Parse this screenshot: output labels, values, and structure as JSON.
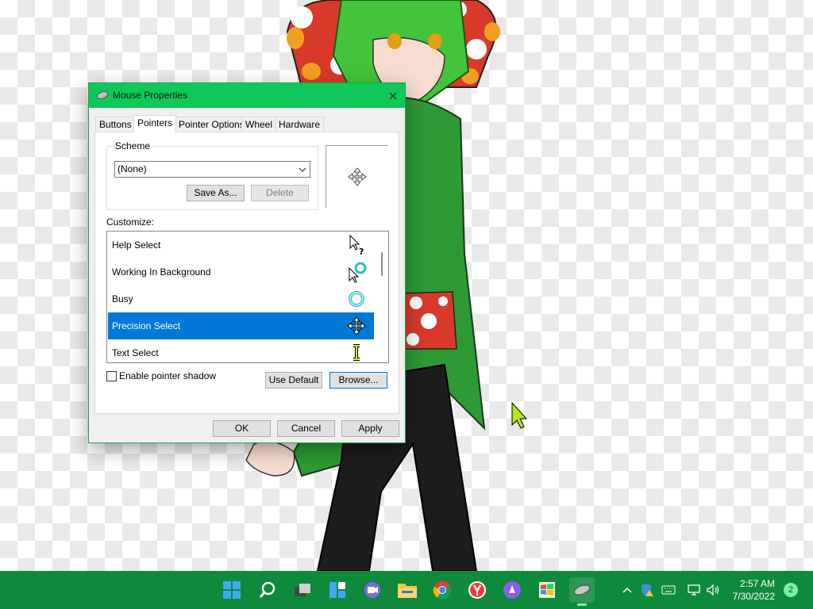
{
  "window": {
    "title": "Mouse Properties",
    "tabs": [
      "Buttons",
      "Pointers",
      "Pointer Options",
      "Wheel",
      "Hardware"
    ],
    "active_tab": "Pointers"
  },
  "scheme": {
    "legend": "Scheme",
    "selected": "(None)",
    "save_as_label": "Save As...",
    "delete_label": "Delete"
  },
  "customize": {
    "label": "Customize:",
    "items": [
      {
        "label": "Help Select",
        "icon": "help-select-cursor-icon"
      },
      {
        "label": "Working In Background",
        "icon": "working-in-background-cursor-icon"
      },
      {
        "label": "Busy",
        "icon": "busy-cursor-icon"
      },
      {
        "label": "Precision Select",
        "icon": "move-cursor-icon",
        "selected": true
      },
      {
        "label": "Text Select",
        "icon": "text-select-cursor-icon"
      }
    ]
  },
  "options": {
    "shadow_label": "Enable pointer shadow",
    "shadow_checked": false,
    "use_default_label": "Use Default",
    "browse_label": "Browse..."
  },
  "footer": {
    "ok_label": "OK",
    "cancel_label": "Cancel",
    "apply_label": "Apply"
  },
  "taskbar": {
    "apps": [
      "start-icon",
      "search-icon",
      "task-view-icon",
      "widgets-icon",
      "chat-icon",
      "file-explorer-icon",
      "chrome-icon",
      "yandex-icon",
      "alice-icon",
      "windows-logo-icon",
      "mouse-icon"
    ],
    "clock_time": "2:57 AM",
    "clock_date": "7/30/2022",
    "notification_count": "2"
  },
  "colors": {
    "titlebar": "#0ec85a",
    "taskbar": "#0f8a3c",
    "selection": "#0078d7"
  }
}
